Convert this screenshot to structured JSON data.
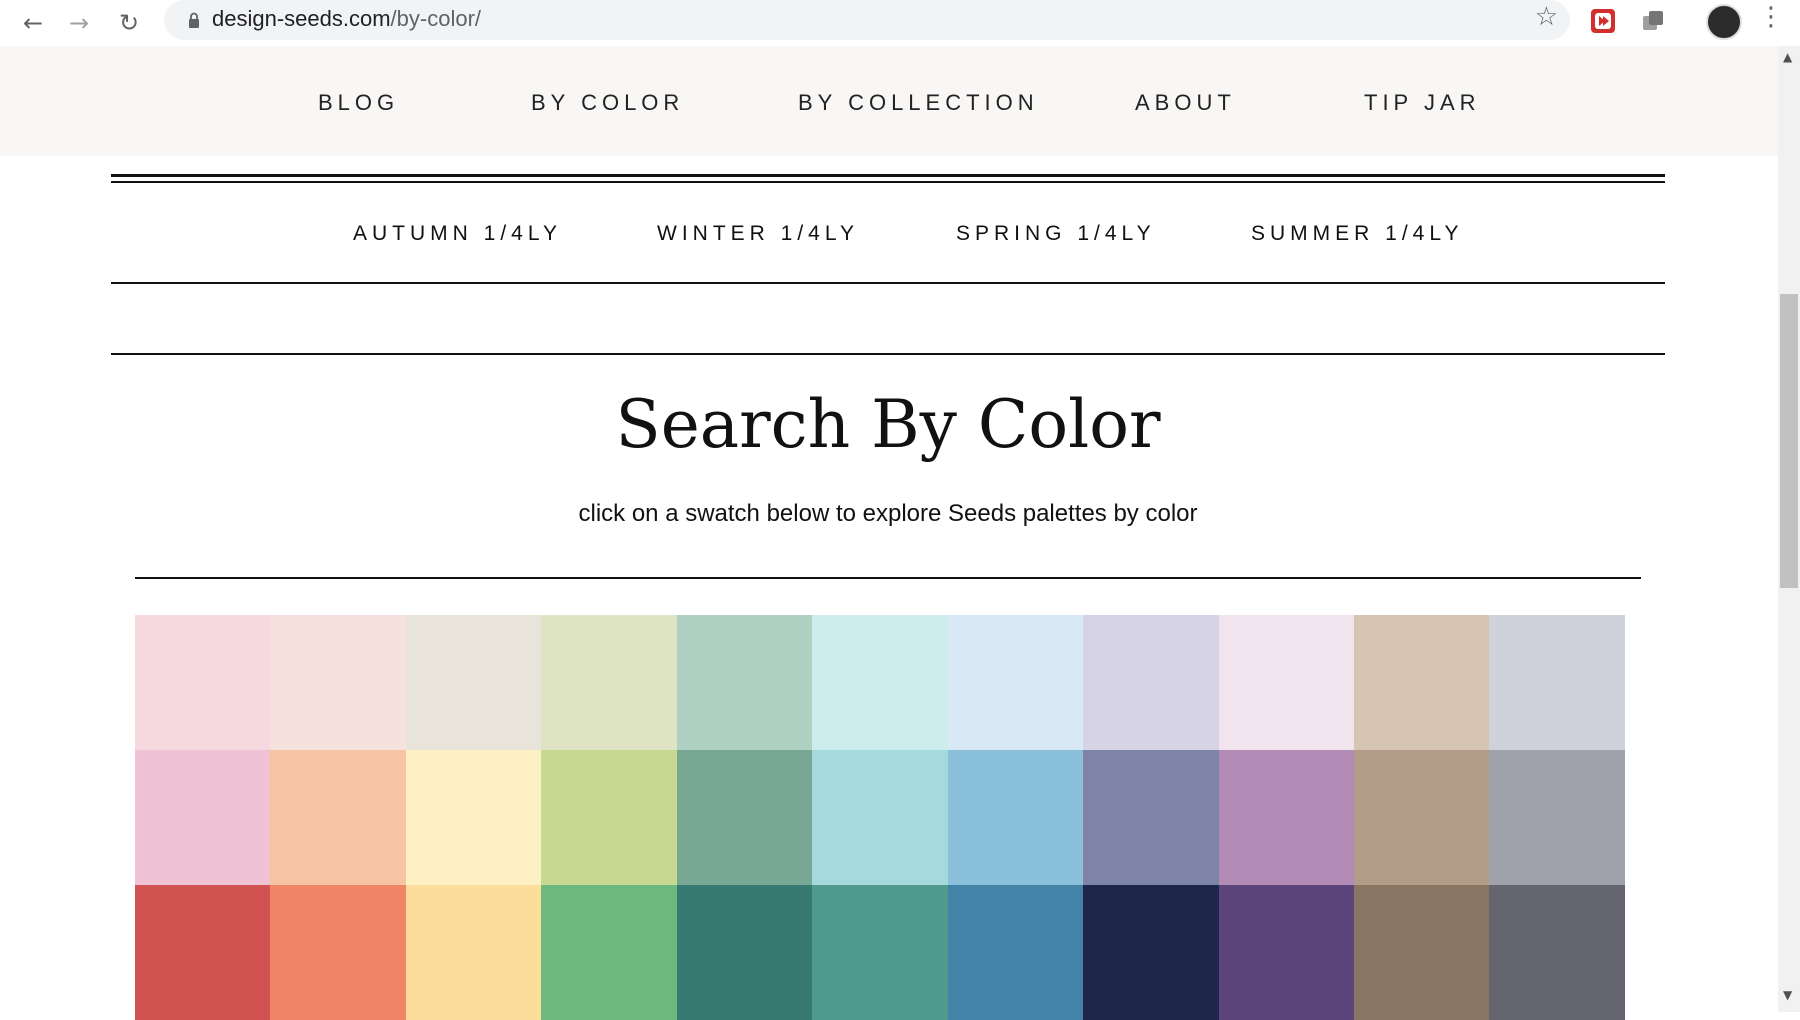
{
  "browser": {
    "url_host": "design-seeds.com",
    "url_path": "/by-color/"
  },
  "nav": {
    "items": [
      "BLOG",
      "BY COLOR",
      "BY COLLECTION",
      "ABOUT",
      "TIP JAR"
    ]
  },
  "subnav": {
    "items": [
      "AUTUMN 1/4LY",
      "WINTER 1/4LY",
      "SPRING 1/4LY",
      "SUMMER 1/4LY"
    ]
  },
  "page": {
    "title": "Search By Color",
    "subtitle": "click on a swatch below to explore Seeds palettes by color"
  },
  "swatches": [
    [
      "#f5d9de",
      "#f5e2de",
      "#e8e4d9",
      "#dfe5c4",
      "#aed1c4",
      "#cdecee",
      "#d8e9f5",
      "#d5d3e4",
      "#f1e4ee",
      "#d6c5b3",
      "#cfd2db"
    ],
    [
      "#efc3d5",
      "#f7c4a3",
      "#fdf1c3",
      "#c7d991",
      "#78a794",
      "#a4dadc",
      "#8bc0dd",
      "#7e83a8",
      "#b18ab6",
      "#b39d88",
      "#a0a2ab"
    ],
    [
      "#d15351",
      "#ef8466",
      "#fcdd9c",
      "#6db87d",
      "#367a72",
      "#50998f",
      "#4383a7",
      "#1f264c",
      "#5a4479",
      "#887564",
      "#65656f"
    ]
  ]
}
